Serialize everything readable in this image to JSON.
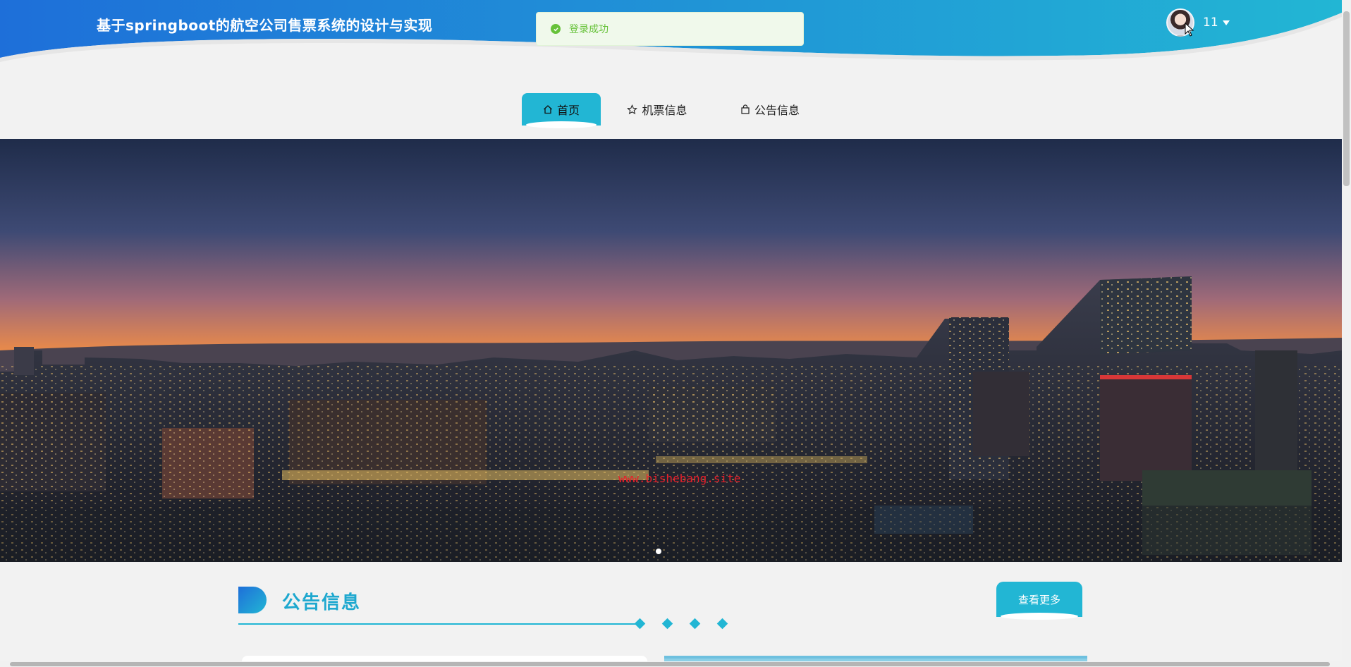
{
  "header": {
    "title": "基于springboot的航空公司售票系统的设计与实现",
    "user_name": "11",
    "gradient_start": "#1e6fd9",
    "gradient_end": "#22b6d4"
  },
  "toast": {
    "message": "登录成功",
    "color": "#67c23a",
    "icon": "check-circle-icon"
  },
  "nav": {
    "items": [
      {
        "label": "首页",
        "icon": "home-icon",
        "active": true
      },
      {
        "label": "机票信息",
        "icon": "star-icon",
        "active": false
      },
      {
        "label": "公告信息",
        "icon": "bag-icon",
        "active": false
      }
    ],
    "accent": "#22b6d4"
  },
  "banner": {
    "watermark": "www.bishebang.site",
    "carousel_dots": 1
  },
  "notice_section": {
    "title": "公告信息",
    "more_label": "查看更多"
  }
}
